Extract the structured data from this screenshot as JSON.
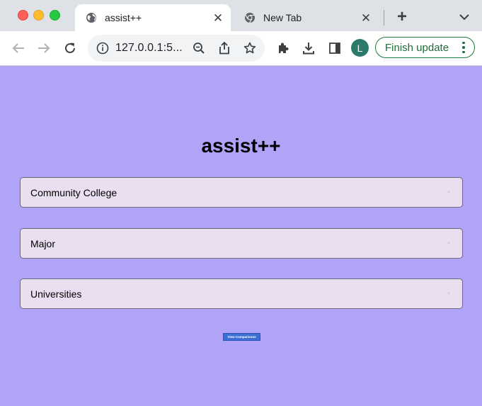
{
  "browser": {
    "tabs": [
      {
        "title": "assist++",
        "favicon": "globe-icon",
        "active": true
      },
      {
        "title": "New Tab",
        "favicon": "chrome-icon",
        "active": false
      }
    ],
    "url": "127.0.0.1:5...",
    "profile_initial": "L",
    "finish_update_label": "Finish update",
    "colors": {
      "profile": "#2b7a6b",
      "update_accent": "#1e7a3a"
    }
  },
  "page": {
    "title": "assist++",
    "background": "#b0a4f9",
    "selects": [
      {
        "label": "Community College"
      },
      {
        "label": "Major"
      },
      {
        "label": "Universities"
      }
    ],
    "compare_button_label": "View Comparisons",
    "colors": {
      "select_bg": "#eadff1",
      "button": "#3b6fd6"
    }
  }
}
